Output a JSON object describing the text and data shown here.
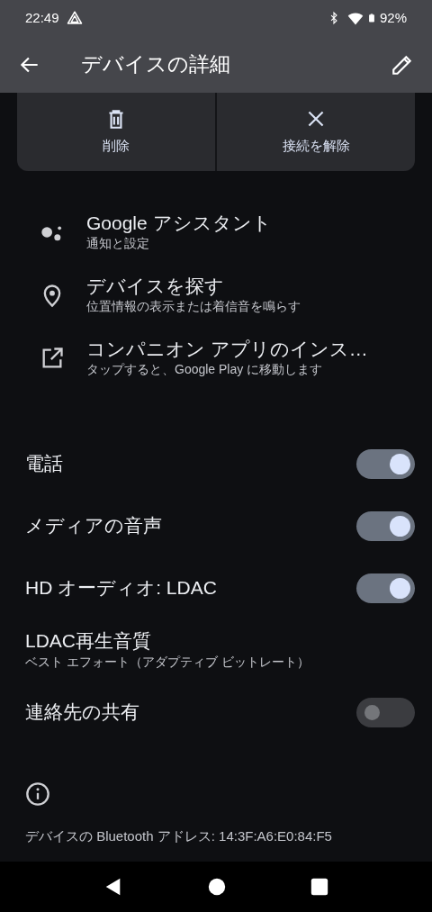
{
  "status_bar": {
    "time": "22:49",
    "battery": "92%"
  },
  "app_bar": {
    "title": "デバイスの詳細"
  },
  "actions": [
    {
      "kind": "delete",
      "label": "削除"
    },
    {
      "kind": "disconnect",
      "label": "接続を解除"
    }
  ],
  "links": [
    {
      "kind": "assistant",
      "title": "Google アシスタント",
      "subtitle": "通知と設定"
    },
    {
      "kind": "location",
      "title": "デバイスを探す",
      "subtitle": "位置情報の表示または着信音を鳴らす"
    },
    {
      "kind": "external",
      "title": "コンパニオン アプリのインス…",
      "subtitle": "タップすると、Google Play に移動します"
    }
  ],
  "settings": [
    {
      "kind": "switch",
      "title": "電話",
      "on": true
    },
    {
      "kind": "switch",
      "title": "メディアの音声",
      "on": true
    },
    {
      "kind": "switch",
      "title": "HD オーディオ: LDAC",
      "on": true
    },
    {
      "kind": "text",
      "title": "LDAC再生音質",
      "subtitle": "ベスト エフォート（アダプティブ ビットレート）"
    },
    {
      "kind": "switch",
      "title": "連絡先の共有",
      "on": false
    }
  ],
  "footer": {
    "address": "デバイスの Bluetooth アドレス: 14:3F:A6:E0:84:F5"
  }
}
